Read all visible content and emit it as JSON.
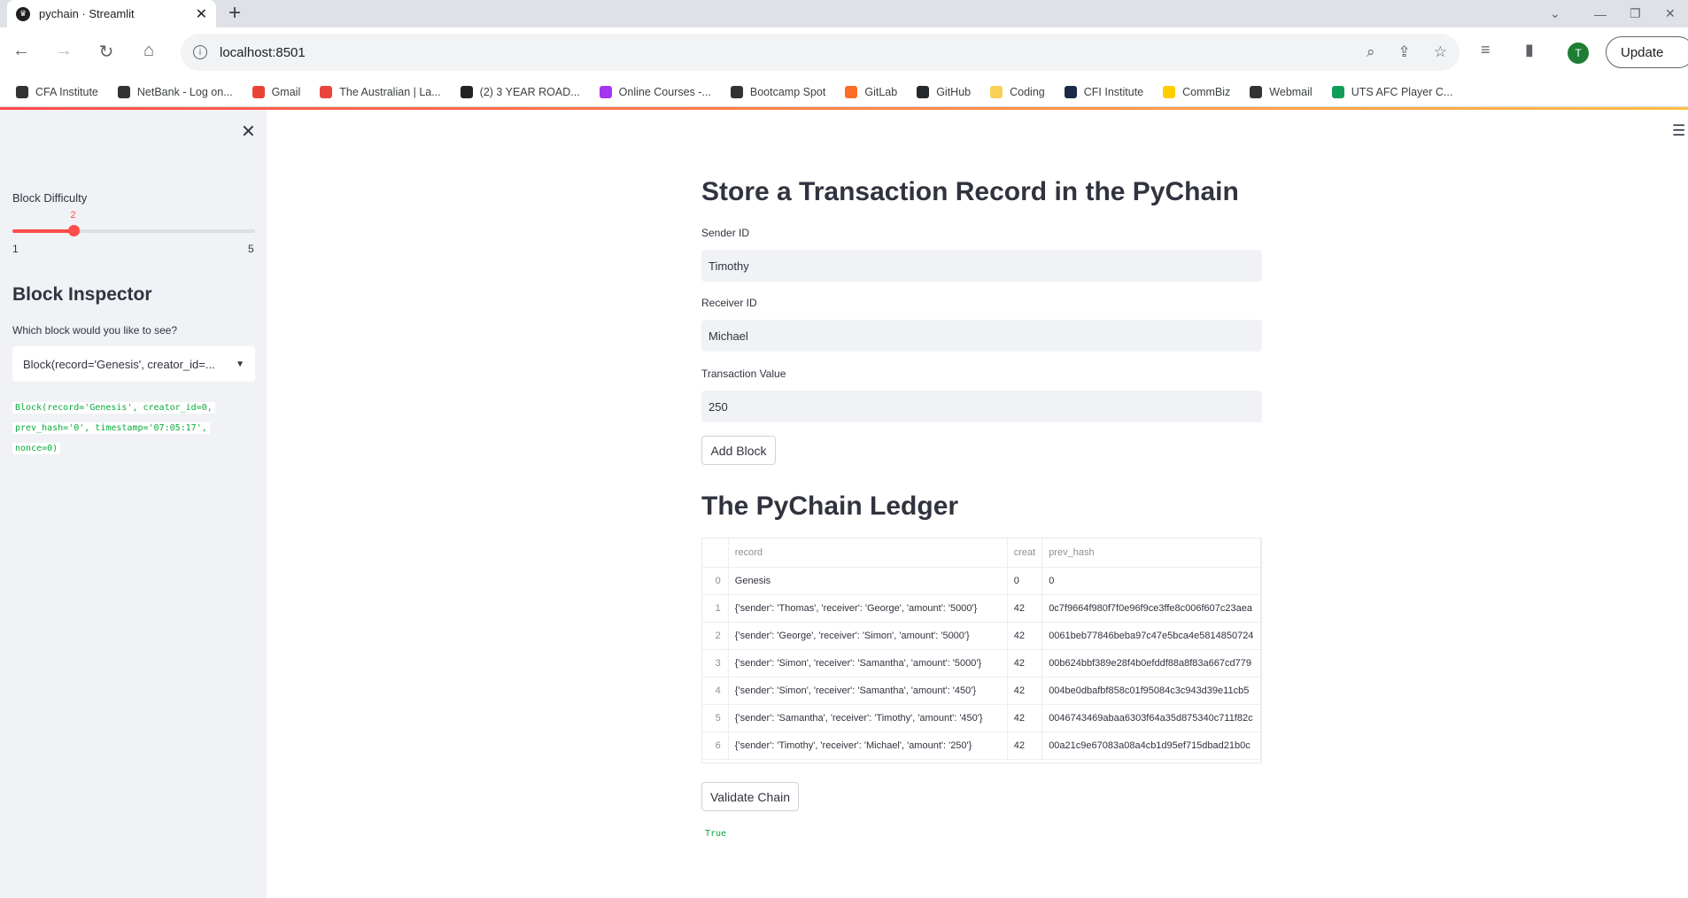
{
  "browser": {
    "tab_title": "pychain · Streamlit",
    "url": "localhost:8501",
    "update_label": "Update",
    "profile_initial": "T",
    "bookmarks": [
      {
        "label": "CFA Institute",
        "color": "#333333"
      },
      {
        "label": "NetBank - Log on...",
        "color": "#333333"
      },
      {
        "label": "Gmail",
        "color": "#ea4335"
      },
      {
        "label": "The Australian | La...",
        "color": "#e8453c"
      },
      {
        "label": "(2) 3 YEAR ROAD...",
        "color": "#222222"
      },
      {
        "label": "Online Courses -...",
        "color": "#a435f0"
      },
      {
        "label": "Bootcamp Spot",
        "color": "#333333"
      },
      {
        "label": "GitLab",
        "color": "#fc6d26"
      },
      {
        "label": "GitHub",
        "color": "#24292e"
      },
      {
        "label": "Coding",
        "color": "#f7d154"
      },
      {
        "label": "CFI Institute",
        "color": "#1b2a4a"
      },
      {
        "label": "CommBiz",
        "color": "#ffcc00"
      },
      {
        "label": "Webmail",
        "color": "#333333"
      },
      {
        "label": "UTS AFC Player C...",
        "color": "#0f9d58"
      }
    ]
  },
  "sidebar": {
    "slider_label": "Block Difficulty",
    "slider_value": "2",
    "slider_min": "1",
    "slider_max": "5",
    "slider_fraction": 0.25,
    "inspector_title": "Block Inspector",
    "inspector_question": "Which block would you like to see?",
    "select_value": "Block(record='Genesis', creator_id=...",
    "block_output": [
      "Block(record='Genesis', creator_id=0,",
      "prev_hash='0', timestamp='07:05:17',",
      "nonce=0)"
    ]
  },
  "main": {
    "store_title": "Store a Transaction Record in the PyChain",
    "sender_label": "Sender ID",
    "sender_value": "Timothy",
    "receiver_label": "Receiver ID",
    "receiver_value": "Michael",
    "value_label": "Transaction Value",
    "value_value": "250",
    "add_block_label": "Add Block",
    "ledger_title": "The PyChain Ledger",
    "table": {
      "columns": [
        "",
        "record",
        "creat",
        "prev_hash"
      ],
      "rows": [
        [
          "0",
          "Genesis",
          "0",
          "0"
        ],
        [
          "1",
          "{'sender': 'Thomas', 'receiver': 'George', 'amount': '5000'}",
          "42",
          "0c7f9664f980f7f0e96f9ce3ffe8c006f607c23aea"
        ],
        [
          "2",
          "{'sender': 'George', 'receiver': 'Simon', 'amount': '5000'}",
          "42",
          "0061beb77846beba97c47e5bca4e5814850724"
        ],
        [
          "3",
          "{'sender': 'Simon', 'receiver': 'Samantha', 'amount': '5000'}",
          "42",
          "00b624bbf389e28f4b0efddf88a8f83a667cd779"
        ],
        [
          "4",
          "{'sender': 'Simon', 'receiver': 'Samantha', 'amount': '450'}",
          "42",
          "004be0dbafbf858c01f95084c3c943d39e11cb5"
        ],
        [
          "5",
          "{'sender': 'Samantha', 'receiver': 'Timothy', 'amount': '450'}",
          "42",
          "0046743469abaa6303f64a35d875340c711f82c"
        ],
        [
          "6",
          "{'sender': 'Timothy', 'receiver': 'Michael', 'amount': '250'}",
          "42",
          "00a21c9e67083a08a4cb1d95ef715dbad21b0c"
        ]
      ]
    },
    "validate_label": "Validate Chain",
    "validate_result": "True"
  }
}
